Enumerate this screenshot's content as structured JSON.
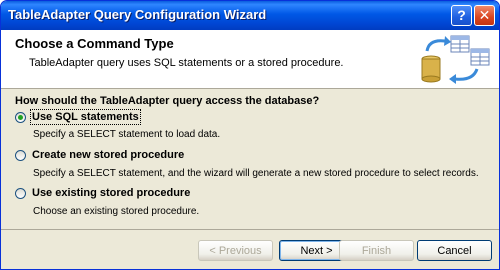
{
  "window": {
    "title": "TableAdapter Query Configuration Wizard",
    "help_glyph": "?",
    "close_glyph": "✕"
  },
  "header": {
    "title": "Choose a Command Type",
    "subtitle": "TableAdapter query uses SQL statements or a stored procedure."
  },
  "body": {
    "question": "How should the TableAdapter query access the database?",
    "options": [
      {
        "label": "Use SQL statements",
        "description": "Specify a SELECT statement to load data.",
        "selected": true
      },
      {
        "label": "Create new stored procedure",
        "description": "Specify a SELECT statement, and the wizard will generate a new stored procedure to select records.",
        "selected": false
      },
      {
        "label": "Use existing stored procedure",
        "description": "Choose an existing stored procedure.",
        "selected": false
      }
    ]
  },
  "buttons": {
    "previous": "< Previous",
    "next": "Next >",
    "finish": "Finish",
    "cancel": "Cancel"
  },
  "colors": {
    "titlebar": "#0058e6",
    "dialog_bg": "#ece9d8",
    "radio_dot": "#21a121"
  }
}
